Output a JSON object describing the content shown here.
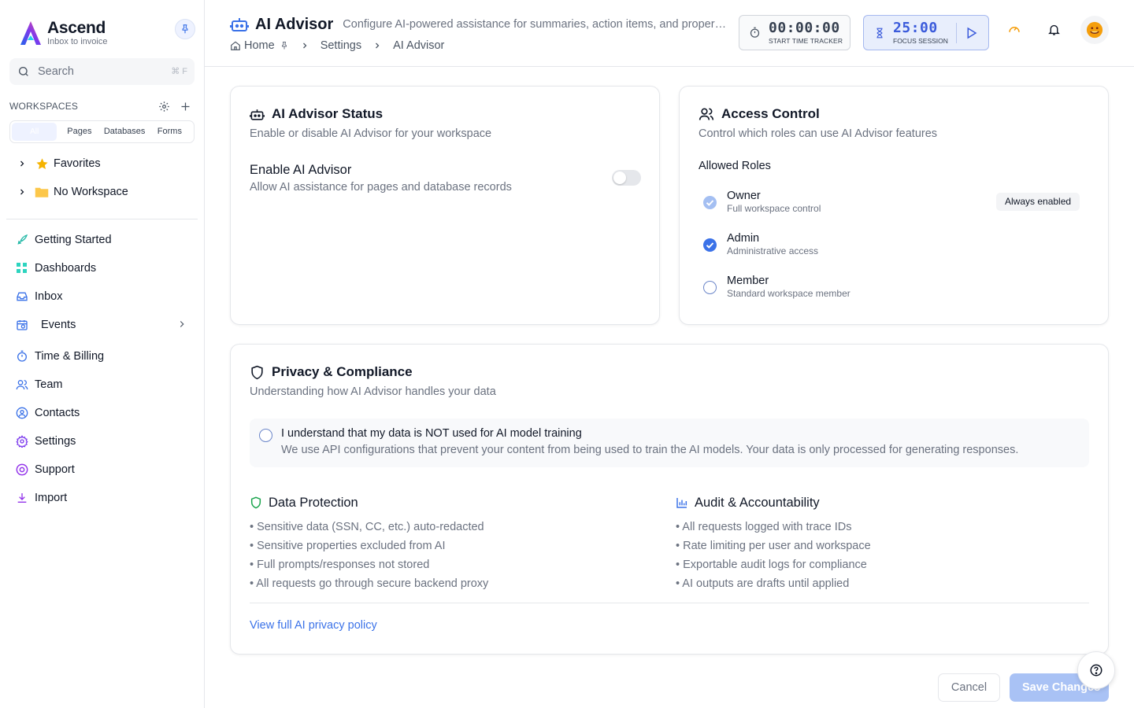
{
  "brand": {
    "name": "Ascend",
    "tagline": "Inbox to invoice"
  },
  "sidebar": {
    "search": {
      "placeholder": "Search",
      "shortcut": "⌘ F"
    },
    "workspaces_label": "WORKSPACES",
    "segments": [
      "All",
      "Pages",
      "Databases",
      "Forms"
    ],
    "tree": [
      {
        "label": "Favorites",
        "icon": "star-icon"
      },
      {
        "label": "No Workspace",
        "icon": "folder-icon"
      }
    ],
    "nav": [
      {
        "label": "Getting Started",
        "icon": "rocket-icon"
      },
      {
        "label": "Dashboards",
        "icon": "grid-icon"
      },
      {
        "label": "Inbox",
        "icon": "inbox-icon"
      },
      {
        "label": "Events",
        "icon": "calendar-icon"
      },
      {
        "label": "Time & Billing",
        "icon": "stopwatch-icon"
      },
      {
        "label": "Team",
        "icon": "users-icon"
      },
      {
        "label": "Contacts",
        "icon": "contact-icon"
      },
      {
        "label": "Settings",
        "icon": "gear-icon"
      },
      {
        "label": "Support",
        "icon": "lifebuoy-icon"
      },
      {
        "label": "Import",
        "icon": "download-icon"
      }
    ]
  },
  "header": {
    "title": "AI Advisor",
    "description": "Configure AI-powered assistance for summaries, action items, and properties",
    "breadcrumbs": [
      "Home",
      "Settings",
      "AI Advisor"
    ],
    "timer": {
      "value": "00:00:00",
      "label": "START TIME TRACKER"
    },
    "focus": {
      "value": "25:00",
      "label": "FOCUS SESSION"
    }
  },
  "status_card": {
    "title": "AI Advisor Status",
    "subtitle": "Enable or disable AI Advisor for your workspace",
    "toggle_label": "Enable AI Advisor",
    "toggle_desc": "Allow AI assistance for pages and database records",
    "enabled": false
  },
  "access_card": {
    "title": "Access Control",
    "subtitle": "Control which roles can use AI Advisor features",
    "roles_label": "Allowed Roles",
    "always_enabled": "Always enabled",
    "roles": [
      {
        "name": "Owner",
        "desc": "Full workspace control",
        "checked": true
      },
      {
        "name": "Admin",
        "desc": "Administrative access",
        "checked": true
      },
      {
        "name": "Member",
        "desc": "Standard workspace member",
        "checked": false
      }
    ]
  },
  "privacy_card": {
    "title": "Privacy & Compliance",
    "subtitle": "Understanding how AI Advisor handles your data",
    "consent_title": "I understand that my data is NOT used for AI model training",
    "consent_desc": "We use API configurations that prevent your content from being used to train the AI models. Your data is only processed for generating responses.",
    "data_protection": {
      "title": "Data Protection",
      "items": [
        "• Sensitive data (SSN, CC, etc.) auto-redacted",
        "• Sensitive properties excluded from AI",
        "• Full prompts/responses not stored",
        "• All requests go through secure backend proxy"
      ]
    },
    "audit": {
      "title": "Audit & Accountability",
      "items": [
        "• All requests logged with trace IDs",
        "• Rate limiting per user and workspace",
        "• Exportable audit logs for compliance",
        "• AI outputs are drafts until applied"
      ]
    },
    "policy_link": "View full AI privacy policy"
  },
  "footer": {
    "cancel": "Cancel",
    "save": "Save Changes"
  },
  "colors": {
    "accent": "#3b72e8",
    "focus_bg": "#e8eefc",
    "save_disabled": "#a9c2f5"
  }
}
